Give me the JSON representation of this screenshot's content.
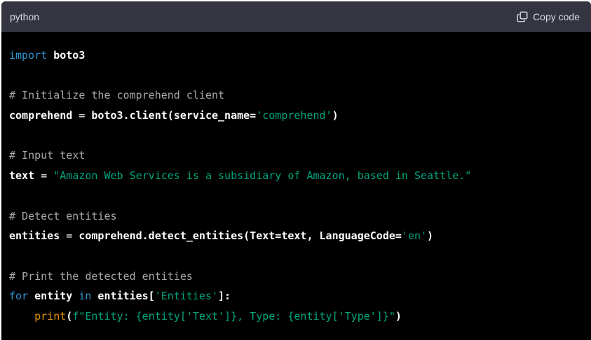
{
  "header": {
    "language": "python",
    "copy_label": "Copy code"
  },
  "code": {
    "l1": {
      "kw": "import",
      "rest": " boto3"
    },
    "l3": {
      "comment": "# Initialize the comprehend client"
    },
    "l4": {
      "a": "comprehend",
      "b": " = ",
      "c": "boto3.client(service_name=",
      "s": "'comprehend'",
      "d": ")"
    },
    "l6": {
      "comment": "# Input text"
    },
    "l7": {
      "a": "text",
      "b": " = ",
      "s": "\"Amazon Web Services is a subsidiary of Amazon, based in Seattle.\""
    },
    "l9": {
      "comment": "# Detect entities"
    },
    "l10": {
      "a": "entities",
      "b": " = ",
      "c": "comprehend.detect_entities(Text=text, LanguageCode=",
      "s": "'en'",
      "d": ")"
    },
    "l12": {
      "comment": "# Print the detected entities"
    },
    "l13": {
      "kw1": "for",
      "a": " entity ",
      "kw2": "in",
      "b": " entities[",
      "s": "'Entities'",
      "c": "]:"
    },
    "l14": {
      "indent": "    ",
      "fn": "print",
      "p1": "(",
      "s": "f\"Entity: {entity['Text']}, Type: {entity['Type']}\"",
      "p2": ")"
    }
  }
}
